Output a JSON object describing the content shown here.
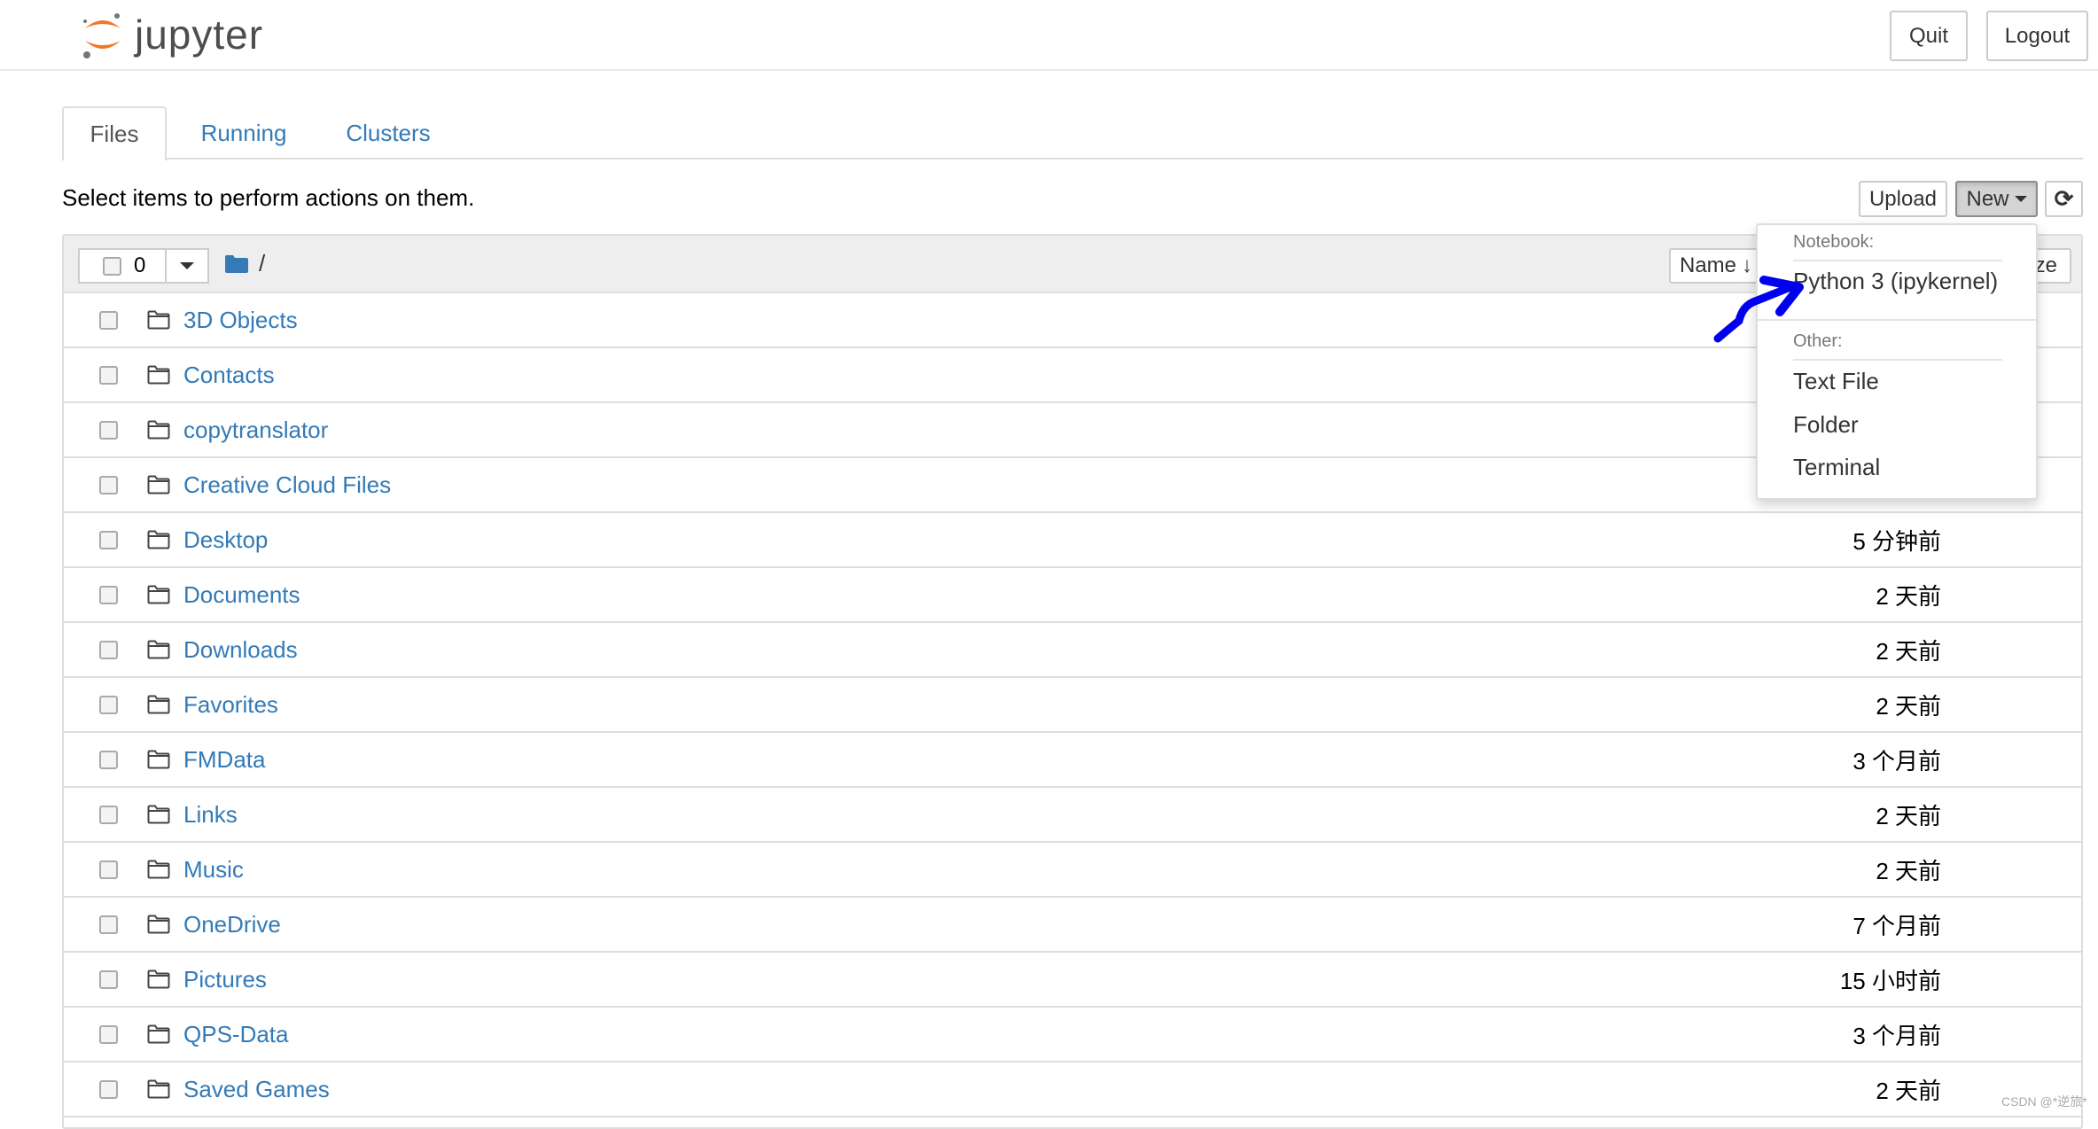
{
  "header": {
    "logo_text": "jupyter",
    "quit_label": "Quit",
    "logout_label": "Logout"
  },
  "tabs": [
    {
      "label": "Files",
      "active": true
    },
    {
      "label": "Running"
    },
    {
      "label": "Clusters"
    }
  ],
  "toolbar": {
    "hint": "Select items to perform actions on them.",
    "upload_label": "Upload",
    "new_label": "New",
    "refresh_icon": "refresh-icon"
  },
  "list_header": {
    "selected_count": "0",
    "breadcrumb": "/",
    "sort_name_label": "Name",
    "sort_size_label_partial": "ze"
  },
  "new_menu": {
    "notebook_header": "Notebook:",
    "notebook_items": [
      "Python 3 (ipykernel)"
    ],
    "other_header": "Other:",
    "other_items": [
      "Text File",
      "Folder",
      "Terminal"
    ]
  },
  "files": [
    {
      "name": "3D Objects",
      "modified": ""
    },
    {
      "name": "Contacts",
      "modified": ""
    },
    {
      "name": "copytranslator",
      "modified": ""
    },
    {
      "name": "Creative Cloud Files",
      "modified": ""
    },
    {
      "name": "Desktop",
      "modified": "5 分钟前"
    },
    {
      "name": "Documents",
      "modified": "2 天前"
    },
    {
      "name": "Downloads",
      "modified": "2 天前"
    },
    {
      "name": "Favorites",
      "modified": "2 天前"
    },
    {
      "name": "FMData",
      "modified": "3 个月前"
    },
    {
      "name": "Links",
      "modified": "2 天前"
    },
    {
      "name": "Music",
      "modified": "2 天前"
    },
    {
      "name": "OneDrive",
      "modified": "7 个月前"
    },
    {
      "name": "Pictures",
      "modified": "15 小时前"
    },
    {
      "name": "QPS-Data",
      "modified": "3 个月前"
    },
    {
      "name": "Saved Games",
      "modified": "2 天前"
    }
  ],
  "watermark": "CSDN @*逆旅*",
  "colors": {
    "link": "#337ab7",
    "logo_orange": "#f37726",
    "annotation_arrow": "#0000ff"
  }
}
